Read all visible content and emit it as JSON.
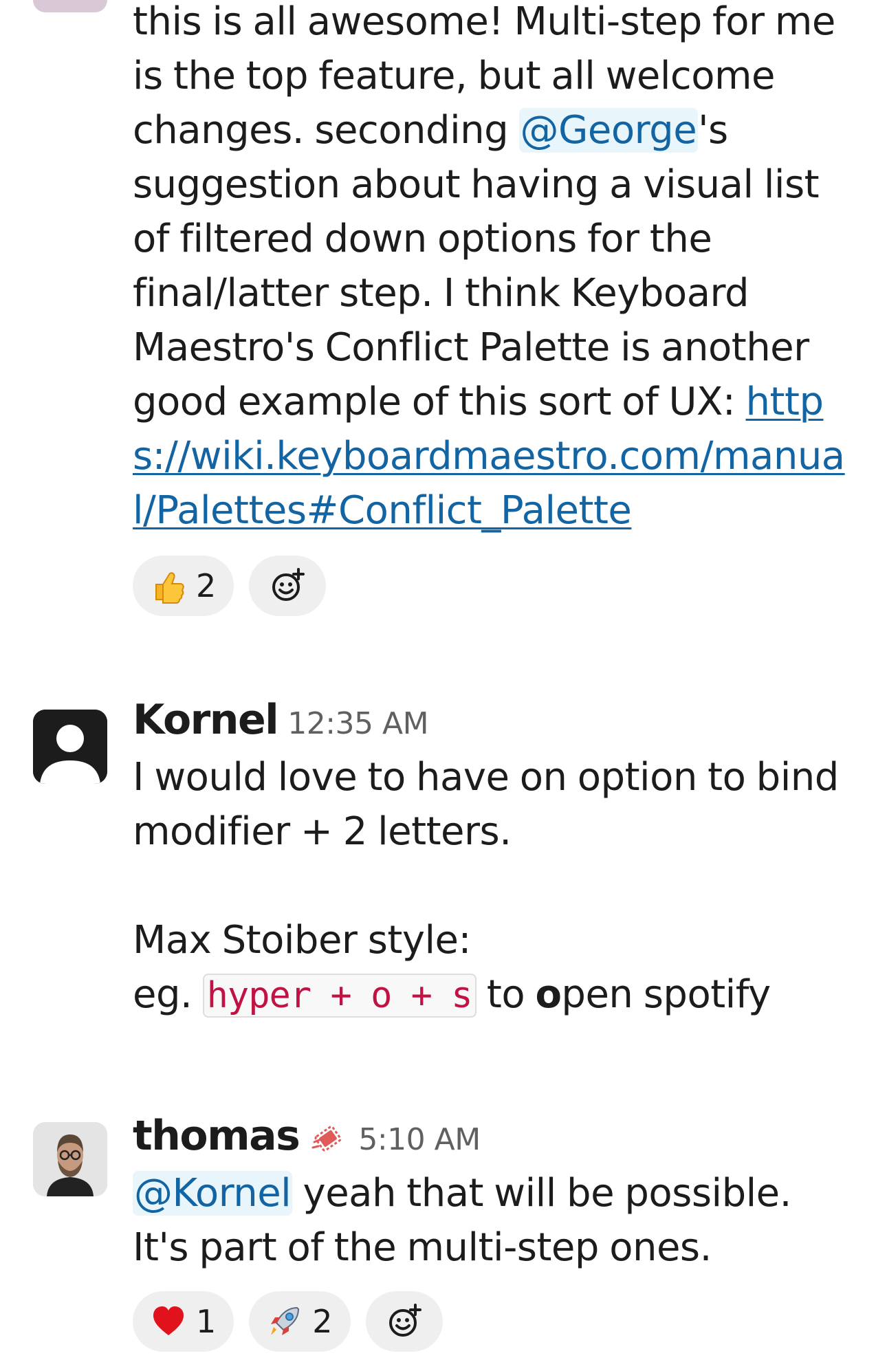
{
  "messages": [
    {
      "text_line1": "this is all awesome! Multi-step for me is the top feature, but all welcome changes. seconding",
      "mention": "@George",
      "text_line2": "'s suggestion about having a visual list of filtered down options for the final/latter step. I think Keyboard Maestro's Conflict Palette is another good example of this sort of UX: ",
      "link": "https://wiki.keyboardmaestro.com/manual/Palettes#Conflict_Palette",
      "reactions": [
        {
          "emoji": "thumbs-up",
          "count": "2"
        }
      ]
    },
    {
      "name": "Kornel",
      "time": "12:35 AM",
      "line1": "I would love to have on option to bind modifier + 2 letters.",
      "line2": "Max Stoiber style:",
      "line3_pre": "eg. ",
      "code": "hyper + o + s",
      "line3_mid": " to ",
      "line3_bold": "o",
      "line3_post": "pen spotify"
    },
    {
      "name": "thomas",
      "time": "5:10 AM",
      "mention": "@Kornel",
      "text": " yeah that will be possible. It's part of the multi-step ones.",
      "reactions": [
        {
          "emoji": "heart",
          "count": "1"
        },
        {
          "emoji": "rocket",
          "count": "2"
        }
      ]
    }
  ],
  "icons": {
    "add_reaction": "add-reaction-icon",
    "status": "status-icon"
  }
}
